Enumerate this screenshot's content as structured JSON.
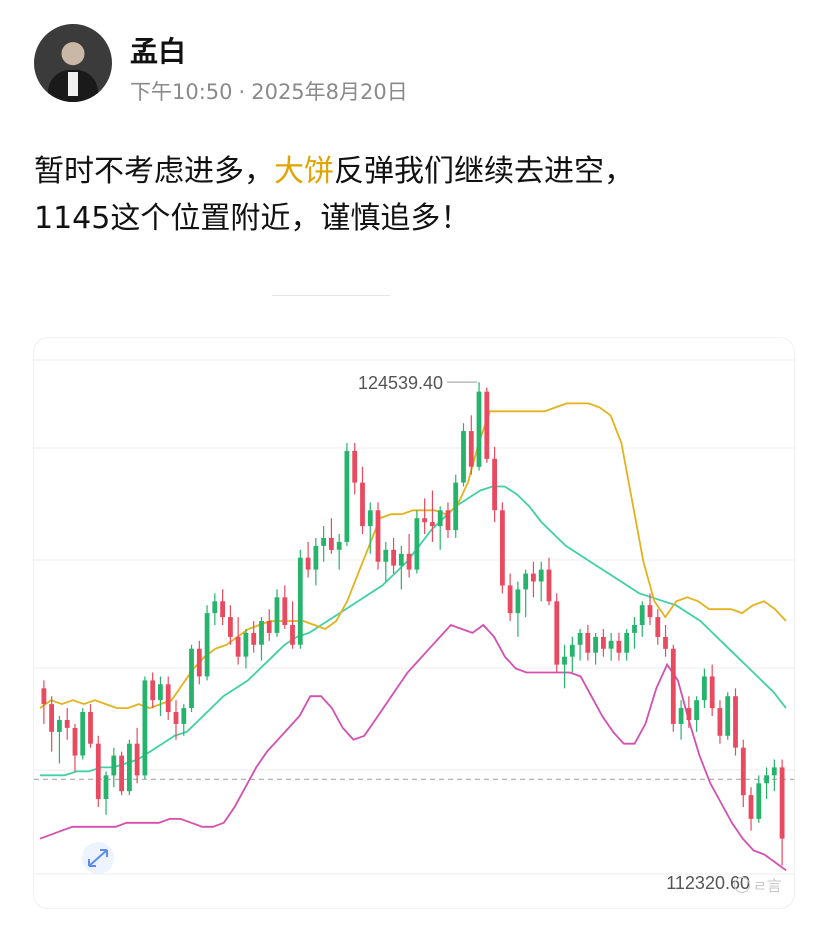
{
  "post": {
    "author": "孟白",
    "time": "下午10:50",
    "separator": "·",
    "date": "2025年8月20日",
    "text_part1": "暂时不考虑进多，",
    "text_highlight": "大饼",
    "text_part2": "反弹我们继续去进空，",
    "text_line2": "1145这个位置附近，谨慎追多！",
    "highlight_color": "#e0a400"
  },
  "watermark": "ㄹ言",
  "chart_data": {
    "type": "candlestick",
    "title": "",
    "xlabel": "",
    "ylabel": "",
    "ylim": [
      111500,
      125300
    ],
    "high_label": "124539.40",
    "low_label": "112320.60",
    "grid": true,
    "dashed_level": 114500,
    "colors": {
      "up": "#26b36b",
      "down": "#e84a5f",
      "upper_band": "#e3b21c",
      "middle_band": "#3fd0a3",
      "lower_band": "#d44fb0",
      "grid": "#eeeeee",
      "dashed": "#aaaaaa"
    },
    "candles": [
      [
        116800,
        117000,
        115900,
        116400
      ],
      [
        116400,
        116600,
        115200,
        115700
      ],
      [
        115700,
        116100,
        114900,
        116000
      ],
      [
        116000,
        116300,
        115500,
        115800
      ],
      [
        115800,
        115900,
        114700,
        115100
      ],
      [
        115100,
        116300,
        115000,
        116200
      ],
      [
        116200,
        116400,
        115300,
        115400
      ],
      [
        115400,
        115600,
        113800,
        114000
      ],
      [
        114000,
        114700,
        113600,
        114600
      ],
      [
        114600,
        115300,
        114300,
        115100
      ],
      [
        115100,
        115200,
        114100,
        114200
      ],
      [
        114200,
        115500,
        114100,
        115400
      ],
      [
        115400,
        115800,
        114400,
        114600
      ],
      [
        114600,
        117100,
        114500,
        117000
      ],
      [
        117000,
        117200,
        116300,
        116500
      ],
      [
        116500,
        117100,
        116100,
        116900
      ],
      [
        116900,
        117100,
        116000,
        116200
      ],
      [
        116200,
        116500,
        115500,
        115900
      ],
      [
        115900,
        116400,
        115600,
        116300
      ],
      [
        116300,
        117900,
        116200,
        117800
      ],
      [
        117800,
        118000,
        116900,
        117100
      ],
      [
        117100,
        118900,
        117000,
        118700
      ],
      [
        118700,
        119200,
        118400,
        119000
      ],
      [
        119000,
        119300,
        118400,
        118600
      ],
      [
        118600,
        118900,
        117900,
        118100
      ],
      [
        118100,
        118600,
        117400,
        117600
      ],
      [
        117600,
        118300,
        117300,
        118200
      ],
      [
        118200,
        118500,
        117700,
        117900
      ],
      [
        117900,
        118600,
        117500,
        118500
      ],
      [
        118500,
        118800,
        118000,
        118200
      ],
      [
        118200,
        119300,
        118100,
        119100
      ],
      [
        119100,
        119400,
        118300,
        118400
      ],
      [
        118400,
        119000,
        117800,
        117900
      ],
      [
        117900,
        120300,
        117800,
        120100
      ],
      [
        120100,
        120500,
        119600,
        119800
      ],
      [
        119800,
        120600,
        119400,
        120400
      ],
      [
        120400,
        120900,
        120000,
        120600
      ],
      [
        120600,
        121100,
        120200,
        120300
      ],
      [
        120300,
        120700,
        119800,
        120500
      ],
      [
        120500,
        123000,
        120400,
        122800
      ],
      [
        122800,
        123000,
        121700,
        122000
      ],
      [
        122000,
        122400,
        120700,
        120900
      ],
      [
        120900,
        121500,
        120200,
        121300
      ],
      [
        121300,
        121500,
        119800,
        120000
      ],
      [
        120000,
        120500,
        119500,
        120300
      ],
      [
        120300,
        120600,
        119700,
        119900
      ],
      [
        119900,
        120400,
        119300,
        120200
      ],
      [
        120200,
        120700,
        119600,
        119800
      ],
      [
        119800,
        121300,
        119700,
        121100
      ],
      [
        121100,
        121600,
        120700,
        121000
      ],
      [
        121000,
        121800,
        120500,
        120900
      ],
      [
        120900,
        121400,
        120300,
        121300
      ],
      [
        121300,
        121500,
        120600,
        120800
      ],
      [
        120800,
        122200,
        120600,
        122000
      ],
      [
        122000,
        123500,
        121900,
        123300
      ],
      [
        123300,
        123700,
        122200,
        122400
      ],
      [
        122400,
        124539.4,
        122300,
        124300
      ],
      [
        124300,
        124400,
        122500,
        122600
      ],
      [
        122600,
        122900,
        121000,
        121300
      ],
      [
        121300,
        121500,
        119200,
        119400
      ],
      [
        119400,
        119700,
        118500,
        118700
      ],
      [
        118700,
        119500,
        118100,
        119300
      ],
      [
        119300,
        119800,
        118600,
        119700
      ],
      [
        119700,
        120000,
        119100,
        119500
      ],
      [
        119500,
        120000,
        119000,
        119800
      ],
      [
        119800,
        120100,
        118900,
        119000
      ],
      [
        119000,
        119200,
        117200,
        117400
      ],
      [
        117400,
        117900,
        116800,
        117600
      ],
      [
        117600,
        118100,
        117200,
        117900
      ],
      [
        117900,
        118300,
        117500,
        118200
      ],
      [
        118200,
        118400,
        117500,
        117700
      ],
      [
        117700,
        118200,
        117400,
        118100
      ],
      [
        118100,
        118300,
        117600,
        117800
      ],
      [
        117800,
        118200,
        117500,
        118000
      ],
      [
        118000,
        118200,
        117500,
        117700
      ],
      [
        117700,
        118300,
        117500,
        118200
      ],
      [
        118200,
        118600,
        117800,
        118400
      ],
      [
        118400,
        119000,
        118100,
        118900
      ],
      [
        118900,
        119200,
        118400,
        118600
      ],
      [
        118600,
        118800,
        117900,
        118100
      ],
      [
        118100,
        118400,
        117600,
        117800
      ],
      [
        117800,
        117900,
        115700,
        115900
      ],
      [
        115900,
        116500,
        115500,
        116300
      ],
      [
        116300,
        116600,
        115800,
        116000
      ],
      [
        116000,
        116600,
        115700,
        116500
      ],
      [
        116500,
        117300,
        116300,
        117100
      ],
      [
        117100,
        117400,
        116100,
        116300
      ],
      [
        116300,
        116500,
        115400,
        115600
      ],
      [
        115600,
        116700,
        115500,
        116600
      ],
      [
        116600,
        116800,
        115100,
        115300
      ],
      [
        115300,
        115500,
        113800,
        114100
      ],
      [
        114100,
        114300,
        113200,
        113500
      ],
      [
        113500,
        114600,
        113400,
        114400
      ],
      [
        114400,
        114800,
        114000,
        114600
      ],
      [
        114600,
        115000,
        114200,
        114800
      ],
      [
        114800,
        115000,
        112320.6,
        113000
      ]
    ],
    "upper_band": [
      116300,
      116500,
      116400,
      116500,
      116400,
      116500,
      116400,
      116300,
      116300,
      116400,
      116300,
      116400,
      116500,
      116900,
      117300,
      117600,
      117800,
      117900,
      118100,
      118300,
      118400,
      118500,
      118500,
      118500,
      118500,
      118400,
      118300,
      118500,
      119000,
      119700,
      120400,
      121100,
      121200,
      121200,
      121300,
      121300,
      121300,
      121200,
      121400,
      122000,
      123000,
      123800,
      123800,
      123800,
      123800,
      123800,
      123800,
      123900,
      124000,
      124000,
      124000,
      123900,
      123700,
      123000,
      121500,
      120000,
      119000,
      118600,
      119000,
      119100,
      119000,
      118800,
      118800,
      118800,
      118700,
      118900,
      119000,
      118800,
      118500
    ],
    "middle_band": [
      114600,
      114600,
      114600,
      114700,
      114700,
      114800,
      114800,
      114900,
      115000,
      115200,
      115400,
      115600,
      115700,
      116000,
      116300,
      116600,
      116800,
      117000,
      117300,
      117600,
      117900,
      118100,
      118200,
      118400,
      118600,
      118800,
      119000,
      119200,
      119400,
      119700,
      120000,
      120400,
      120800,
      121100,
      121400,
      121600,
      121800,
      121900,
      121900,
      121700,
      121400,
      121000,
      120700,
      120400,
      120200,
      120000,
      119800,
      119600,
      119400,
      119200,
      119100,
      119000,
      118900,
      118700,
      118500,
      118200,
      117900,
      117600,
      117300,
      117000,
      116700,
      116300
    ],
    "lower_band": [
      113000,
      113100,
      113200,
      113300,
      113300,
      113300,
      113300,
      113300,
      113400,
      113400,
      113400,
      113400,
      113500,
      113500,
      113400,
      113300,
      113300,
      113400,
      113800,
      114300,
      114800,
      115200,
      115500,
      115800,
      116100,
      116600,
      116600,
      116300,
      115800,
      115500,
      115600,
      116000,
      116400,
      116800,
      117200,
      117500,
      117800,
      118100,
      118400,
      118300,
      118200,
      118400,
      118100,
      117600,
      117300,
      117200,
      117200,
      117200,
      117200,
      117200,
      117100,
      116600,
      116100,
      115700,
      115400,
      115400,
      115900,
      116800,
      117400,
      117000,
      116000,
      115100,
      114400,
      113900,
      113400,
      113000,
      112700,
      112600,
      112400,
      112200
    ]
  }
}
